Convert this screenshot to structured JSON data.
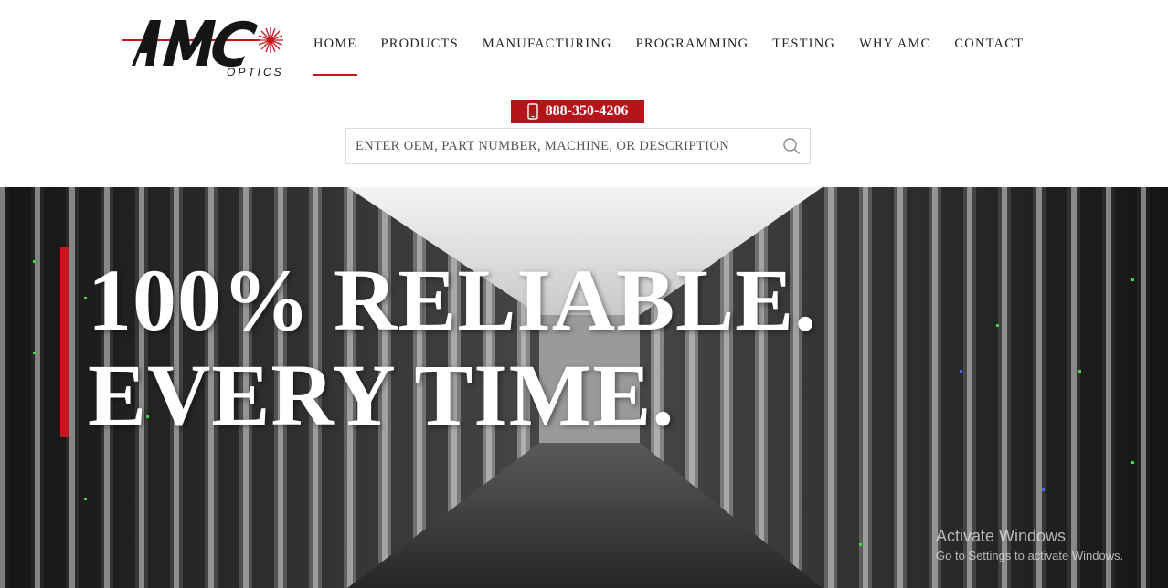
{
  "logo": {
    "text": "AMC",
    "subtitle": "OPTICS",
    "brand_red": "#c8161d"
  },
  "nav": {
    "items": [
      {
        "label": "HOME",
        "active": true
      },
      {
        "label": "PRODUCTS"
      },
      {
        "label": "MANUFACTURING"
      },
      {
        "label": "PROGRAMMING"
      },
      {
        "label": "TESTING"
      },
      {
        "label": "WHY AMC"
      },
      {
        "label": "CONTACT"
      }
    ]
  },
  "phone": {
    "number": "888-350-4206",
    "icon": "mobile-phone-icon",
    "color": "#b5141b"
  },
  "search": {
    "placeholder": "ENTER OEM, PART NUMBER, MACHINE, OR DESCRIPTION",
    "value": "",
    "icon": "search-icon"
  },
  "hero": {
    "line1": "100% RELIABLE.",
    "line2": "EVERY TIME."
  },
  "watermark": {
    "title": "Activate Windows",
    "subtitle": "Go to Settings to activate Windows."
  }
}
